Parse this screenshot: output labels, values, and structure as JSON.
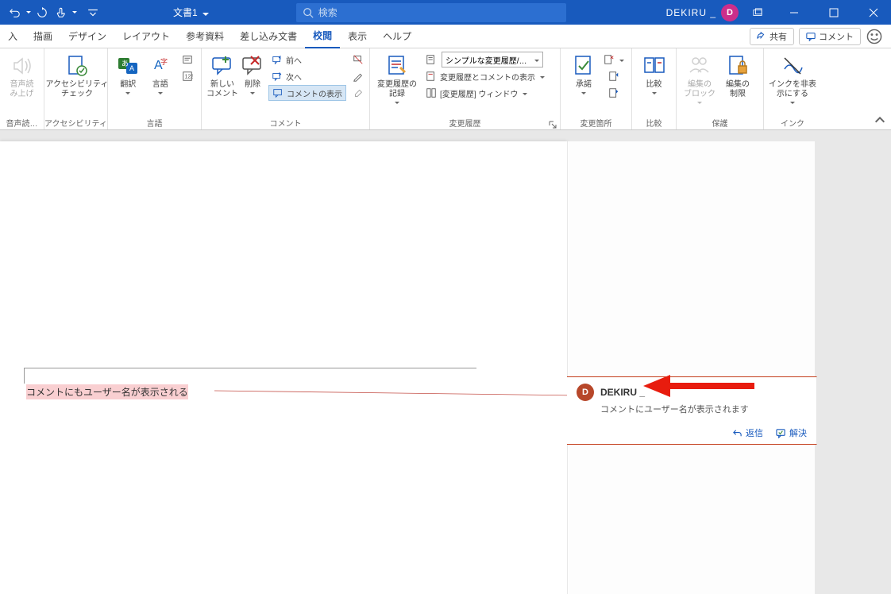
{
  "titlebar": {
    "doc_title": "文書1",
    "search_placeholder": "検索",
    "user_name": "DEKIRU _",
    "avatar_letter": "D"
  },
  "tabs": {
    "items": [
      "入",
      "描画",
      "デザイン",
      "レイアウト",
      "参考資料",
      "差し込み文書",
      "校閲",
      "表示",
      "ヘルプ"
    ],
    "active_index": 6,
    "share": "共有",
    "comment": "コメント"
  },
  "ribbon": {
    "groups": {
      "speech": {
        "label": "音声読…",
        "read_aloud": "音声読\nみ上げ"
      },
      "accessibility": {
        "label": "アクセシビリティ",
        "check": "アクセシビリティ\nチェック"
      },
      "language": {
        "label": "言語",
        "translate": "翻訳",
        "language": "言語"
      },
      "comments": {
        "label": "コメント",
        "new_comment": "新しい\nコメント",
        "delete": "削除",
        "previous": "前へ",
        "next": "次へ",
        "show_comments": "コメントの表示"
      },
      "tracking": {
        "label": "変更履歴",
        "track_changes": "変更履歴の\n記録",
        "display_mode": "シンプルな変更履歴/コ…",
        "show_markup": "変更履歴とコメントの表示",
        "reviewing_pane": "[変更履歴] ウィンドウ"
      },
      "changes": {
        "label": "変更箇所",
        "accept": "承諾"
      },
      "compare": {
        "label": "比較",
        "compare": "比較"
      },
      "protect": {
        "label": "保護",
        "block_authors": "編集の\nブロック",
        "restrict": "編集の\n制限"
      },
      "ink": {
        "label": "インク",
        "hide_ink": "インクを非表\n示にする"
      }
    }
  },
  "document": {
    "highlighted_text": "コメントにもユーザー名が表示される"
  },
  "comment": {
    "avatar_letter": "D",
    "author": "DEKIRU _",
    "text": "コメントにユーザー名が表示されます",
    "reply": "返信",
    "resolve": "解決"
  }
}
